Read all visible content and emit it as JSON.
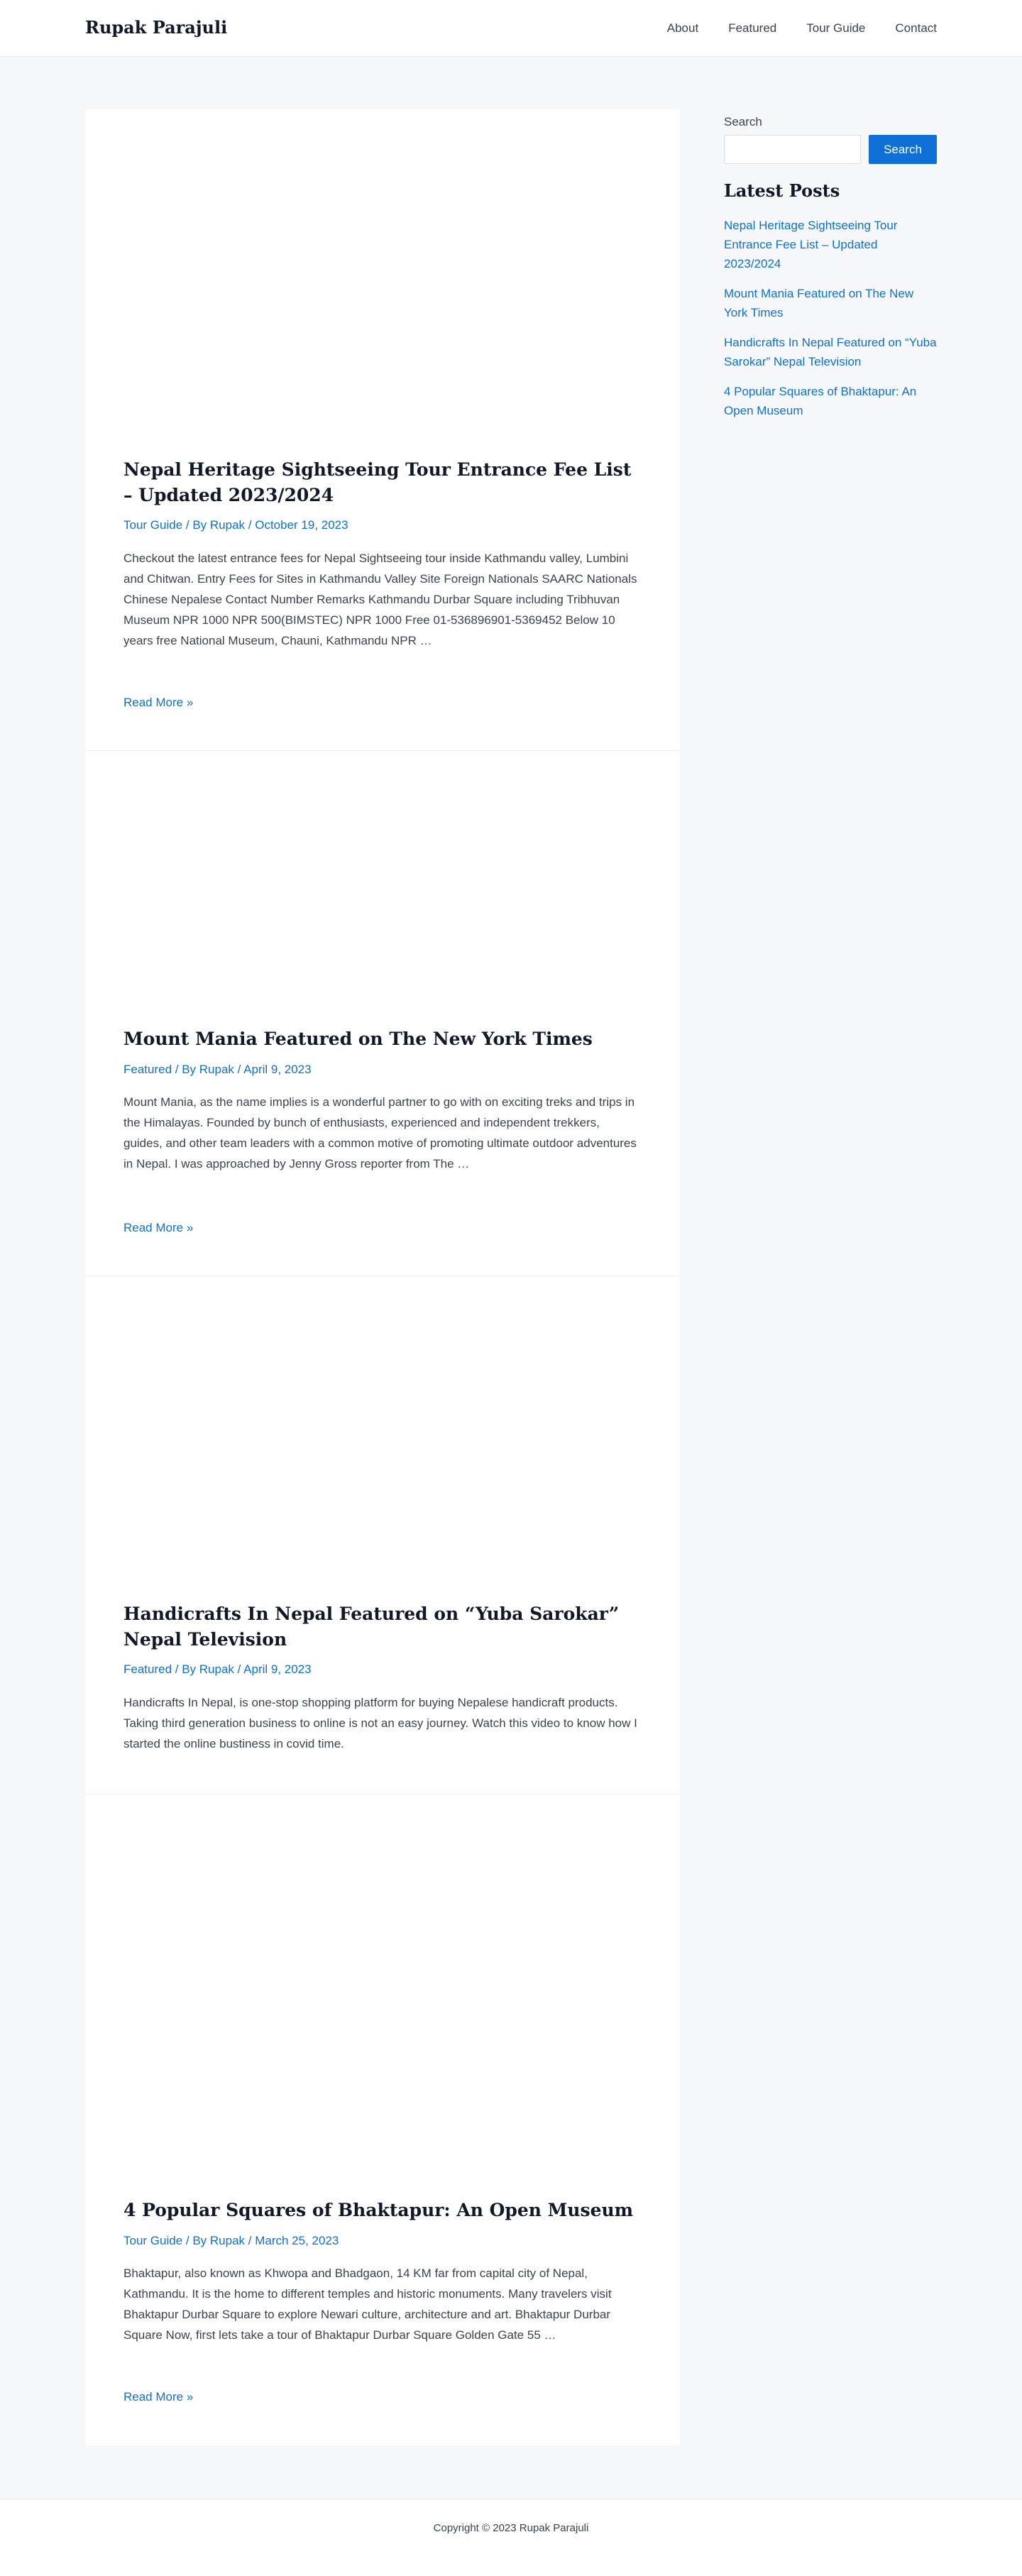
{
  "header": {
    "site_title": "Rupak Parajuli",
    "nav": [
      "About",
      "Featured",
      "Tour Guide",
      "Contact"
    ]
  },
  "posts": [
    {
      "title": "Nepal Heritage Sightseeing Tour Entrance Fee List – Updated 2023/2024",
      "category": "Tour Guide",
      "author": "Rupak",
      "date": "October 19, 2023",
      "excerpt": "Checkout the latest entrance fees for Nepal Sightseeing tour inside Kathmandu valley, Lumbini and Chitwan. Entry Fees for Sites in Kathmandu Valley Site Foreign Nationals SAARC Nationals Chinese Nepalese Contact Number Remarks Kathmandu Durbar Square including Tribhuvan Museum NPR 1000 NPR 500(BIMSTEC) NPR 1000 Free 01-536896901-5369452 Below 10 years free National Museum, Chauni, Kathmandu NPR …",
      "read_more": "Read More »"
    },
    {
      "title": "Mount Mania Featured on The New York Times",
      "category": "Featured",
      "author": "Rupak",
      "date": "April 9, 2023",
      "excerpt": "Mount Mania, as the name implies is a wonderful partner to go with on exciting treks and trips in the Himalayas. Founded by bunch of enthusiasts, experienced and independent trekkers, guides, and other team leaders with a common motive of promoting ultimate outdoor adventures in Nepal. I was approached by Jenny Gross reporter from The …",
      "read_more": "Read More »"
    },
    {
      "title": "Handicrafts In Nepal Featured on “Yuba Sarokar” Nepal Television",
      "category": "Featured",
      "author": "Rupak",
      "date": "April 9, 2023",
      "excerpt": "Handicrafts In Nepal, is one-stop shopping platform for buying Nepalese handicraft products. Taking third generation business to online is not an easy journey. Watch this video to know how I started the online bustiness in covid time."
    },
    {
      "title": "4 Popular Squares of Bhaktapur: An Open Museum",
      "category": "Tour Guide",
      "author": "Rupak",
      "date": "March 25, 2023",
      "excerpt": "Bhaktapur, also known as Khwopa and Bhadgaon, 14 KM far from capital city of Nepal, Kathmandu. It is the home to different temples and historic monuments. Many travelers visit Bhaktapur Durbar Square to explore Newari culture, architecture and art. Bhaktapur Durbar Square Now, first lets take a tour of Bhaktapur Durbar Square Golden Gate 55 …",
      "read_more": "Read More »"
    }
  ],
  "meta_sep": " / ",
  "by_prefix": "By ",
  "sidebar": {
    "search_label": "Search",
    "search_button": "Search",
    "latest_title": "Latest Posts",
    "latest_posts": [
      "Nepal Heritage Sightseeing Tour Entrance Fee List – Updated 2023/2024",
      "Mount Mania Featured on The New York Times",
      "Handicrafts In Nepal Featured on “Yuba Sarokar” Nepal Television",
      "4 Popular Squares of Bhaktapur: An Open Museum"
    ]
  },
  "footer": {
    "copyright": "Copyright © 2023 Rupak Parajuli"
  },
  "colors": {
    "accent": "#0e6fd6",
    "page_bg": "#f6f7f9",
    "heading": "#111827"
  }
}
